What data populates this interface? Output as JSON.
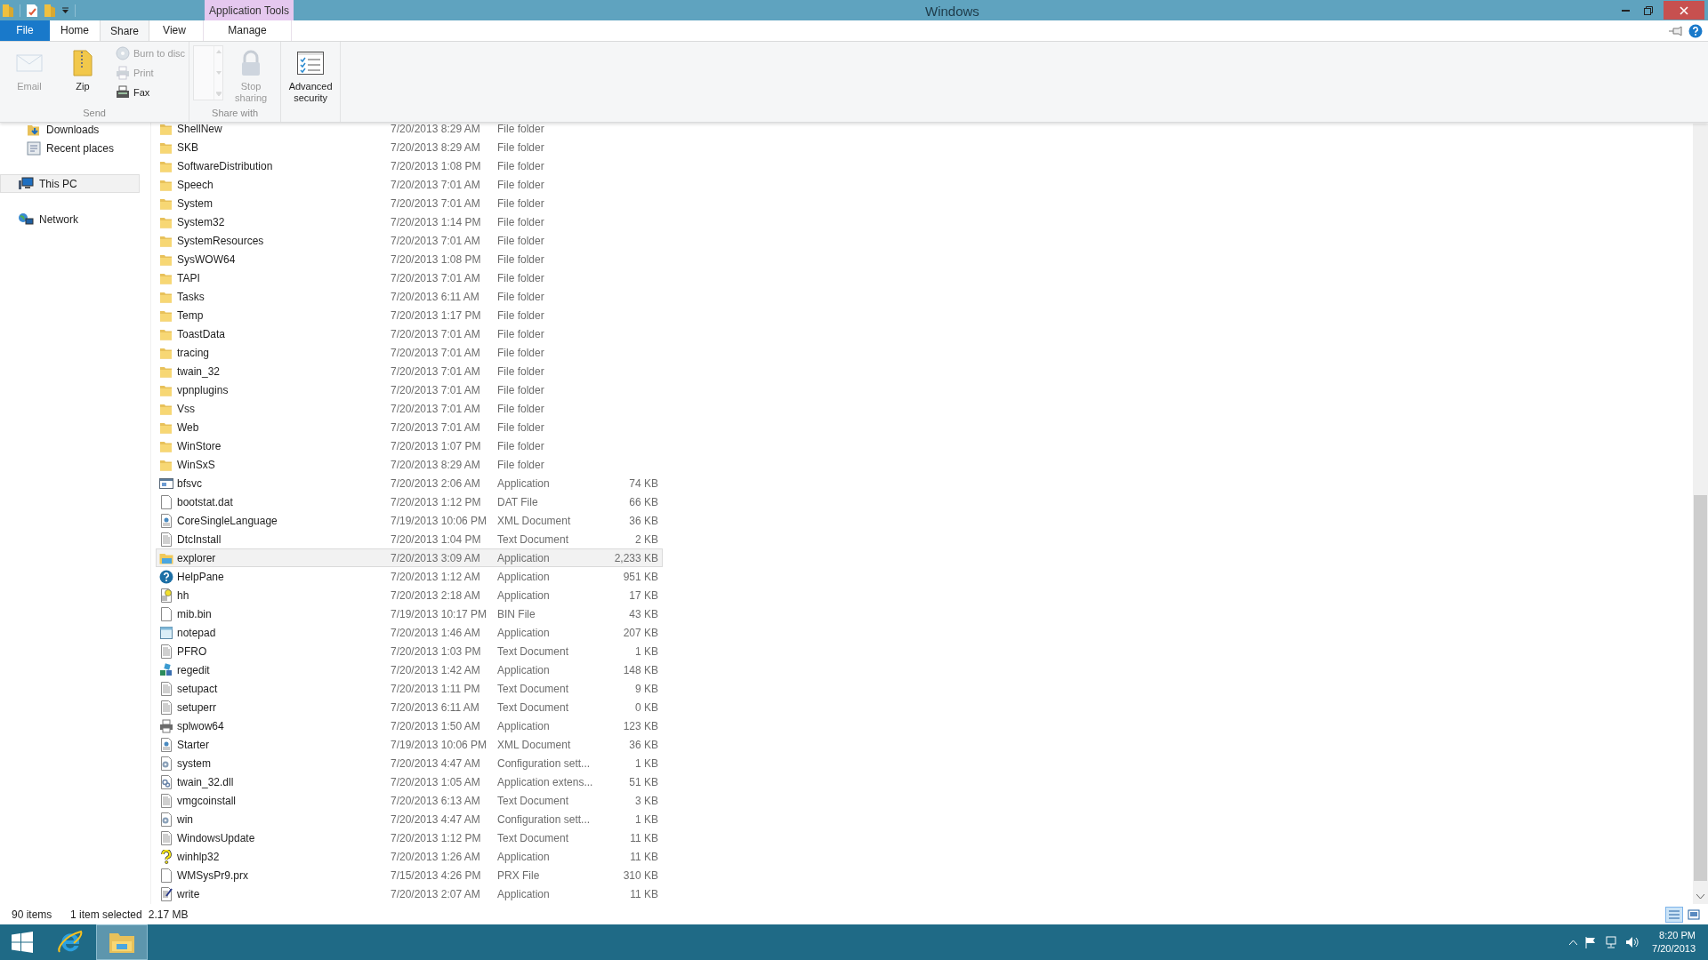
{
  "window": {
    "title": "Windows"
  },
  "contextual_tab": {
    "label": "Application Tools"
  },
  "tabs": [
    {
      "label": "File",
      "kind": "file",
      "selected": false
    },
    {
      "label": "Home",
      "kind": "tab",
      "selected": false
    },
    {
      "label": "Share",
      "kind": "tab",
      "selected": true
    },
    {
      "label": "View",
      "kind": "tab",
      "selected": false
    },
    {
      "label": "Manage",
      "kind": "contextual",
      "selected": false
    }
  ],
  "ribbon": {
    "groups": [
      {
        "label": "Send",
        "items": [
          {
            "label": "Email",
            "kind": "email",
            "disabled": true
          },
          {
            "label": "Zip",
            "kind": "zip",
            "disabled": false
          },
          {
            "label": "Burn to disc",
            "kind": "disc",
            "disabled": true
          },
          {
            "label": "Print",
            "kind": "print",
            "disabled": true
          },
          {
            "label": "Fax",
            "kind": "fax",
            "disabled": false
          }
        ]
      },
      {
        "label": "Share with",
        "items": [
          {
            "kind": "gallery",
            "disabled": true
          },
          {
            "label": "Stop sharing",
            "kind": "lock",
            "disabled": true
          }
        ]
      },
      {
        "items": [
          {
            "label": "Advanced security",
            "kind": "security",
            "disabled": false
          }
        ]
      }
    ]
  },
  "nav": {
    "items": [
      {
        "label": "Downloads",
        "kind": "downloads",
        "selected": false
      },
      {
        "label": "Recent places",
        "kind": "recent",
        "selected": false
      },
      {
        "label": "This PC",
        "kind": "pc",
        "selected": true
      },
      {
        "label": "Network",
        "kind": "network",
        "selected": false
      }
    ]
  },
  "files": [
    {
      "name": "ShellNew",
      "date": "7/20/2013 8:29 AM",
      "type": "File folder",
      "kind": "folder",
      "selected": false
    },
    {
      "name": "SKB",
      "date": "7/20/2013 8:29 AM",
      "type": "File folder",
      "kind": "folder",
      "selected": false
    },
    {
      "name": "SoftwareDistribution",
      "date": "7/20/2013 1:08 PM",
      "type": "File folder",
      "kind": "folder",
      "selected": false
    },
    {
      "name": "Speech",
      "date": "7/20/2013 7:01 AM",
      "type": "File folder",
      "kind": "folder",
      "selected": false
    },
    {
      "name": "System",
      "date": "7/20/2013 7:01 AM",
      "type": "File folder",
      "kind": "folder",
      "selected": false
    },
    {
      "name": "System32",
      "date": "7/20/2013 1:14 PM",
      "type": "File folder",
      "kind": "folder",
      "selected": false
    },
    {
      "name": "SystemResources",
      "date": "7/20/2013 7:01 AM",
      "type": "File folder",
      "kind": "folder",
      "selected": false
    },
    {
      "name": "SysWOW64",
      "date": "7/20/2013 1:08 PM",
      "type": "File folder",
      "kind": "folder",
      "selected": false
    },
    {
      "name": "TAPI",
      "date": "7/20/2013 7:01 AM",
      "type": "File folder",
      "kind": "folder",
      "selected": false
    },
    {
      "name": "Tasks",
      "date": "7/20/2013 6:11 AM",
      "type": "File folder",
      "kind": "folder",
      "selected": false
    },
    {
      "name": "Temp",
      "date": "7/20/2013 1:17 PM",
      "type": "File folder",
      "kind": "folder",
      "selected": false
    },
    {
      "name": "ToastData",
      "date": "7/20/2013 7:01 AM",
      "type": "File folder",
      "kind": "folder",
      "selected": false
    },
    {
      "name": "tracing",
      "date": "7/20/2013 7:01 AM",
      "type": "File folder",
      "kind": "folder",
      "selected": false
    },
    {
      "name": "twain_32",
      "date": "7/20/2013 7:01 AM",
      "type": "File folder",
      "kind": "folder",
      "selected": false
    },
    {
      "name": "vpnplugins",
      "date": "7/20/2013 7:01 AM",
      "type": "File folder",
      "kind": "folder",
      "selected": false
    },
    {
      "name": "Vss",
      "date": "7/20/2013 7:01 AM",
      "type": "File folder",
      "kind": "folder",
      "selected": false
    },
    {
      "name": "Web",
      "date": "7/20/2013 7:01 AM",
      "type": "File folder",
      "kind": "folder",
      "selected": false
    },
    {
      "name": "WinStore",
      "date": "7/20/2013 1:07 PM",
      "type": "File folder",
      "kind": "folder",
      "selected": false
    },
    {
      "name": "WinSxS",
      "date": "7/20/2013 8:29 AM",
      "type": "File folder",
      "kind": "folder",
      "selected": false
    },
    {
      "name": "bfsvc",
      "date": "7/20/2013 2:06 AM",
      "type": "Application",
      "size": "74 KB",
      "kind": "app",
      "selected": false
    },
    {
      "name": "bootstat.dat",
      "date": "7/20/2013 1:12 PM",
      "type": "DAT File",
      "size": "66 KB",
      "kind": "file",
      "selected": false
    },
    {
      "name": "CoreSingleLanguage",
      "date": "7/19/2013 10:06 PM",
      "type": "XML Document",
      "size": "36 KB",
      "kind": "xml",
      "selected": false
    },
    {
      "name": "DtcInstall",
      "date": "7/20/2013 1:04 PM",
      "type": "Text Document",
      "size": "2 KB",
      "kind": "text",
      "selected": false
    },
    {
      "name": "explorer",
      "date": "7/20/2013 3:09 AM",
      "type": "Application",
      "size": "2,233 KB",
      "kind": "explorer",
      "selected": true
    },
    {
      "name": "HelpPane",
      "date": "7/20/2013 1:12 AM",
      "type": "Application",
      "size": "951 KB",
      "kind": "help",
      "selected": false
    },
    {
      "name": "hh",
      "date": "7/20/2013 2:18 AM",
      "type": "Application",
      "size": "17 KB",
      "kind": "hh",
      "selected": false
    },
    {
      "name": "mib.bin",
      "date": "7/19/2013 10:17 PM",
      "type": "BIN File",
      "size": "43 KB",
      "kind": "file",
      "selected": false
    },
    {
      "name": "notepad",
      "date": "7/20/2013 1:46 AM",
      "type": "Application",
      "size": "207 KB",
      "kind": "notepad",
      "selected": false
    },
    {
      "name": "PFRO",
      "date": "7/20/2013 1:03 PM",
      "type": "Text Document",
      "size": "1 KB",
      "kind": "text",
      "selected": false
    },
    {
      "name": "regedit",
      "date": "7/20/2013 1:42 AM",
      "type": "Application",
      "size": "148 KB",
      "kind": "regedit",
      "selected": false
    },
    {
      "name": "setupact",
      "date": "7/20/2013 1:11 PM",
      "type": "Text Document",
      "size": "9 KB",
      "kind": "text",
      "selected": false
    },
    {
      "name": "setuperr",
      "date": "7/20/2013 6:11 AM",
      "type": "Text Document",
      "size": "0 KB",
      "kind": "text",
      "selected": false
    },
    {
      "name": "splwow64",
      "date": "7/20/2013 1:50 AM",
      "type": "Application",
      "size": "123 KB",
      "kind": "printer",
      "selected": false
    },
    {
      "name": "Starter",
      "date": "7/19/2013 10:06 PM",
      "type": "XML Document",
      "size": "36 KB",
      "kind": "xml",
      "selected": false
    },
    {
      "name": "system",
      "date": "7/20/2013 4:47 AM",
      "type": "Configuration sett...",
      "size": "1 KB",
      "kind": "config",
      "selected": false
    },
    {
      "name": "twain_32.dll",
      "date": "7/20/2013 1:05 AM",
      "type": "Application extens...",
      "size": "51 KB",
      "kind": "dll",
      "selected": false
    },
    {
      "name": "vmgcoinstall",
      "date": "7/20/2013 6:13 AM",
      "type": "Text Document",
      "size": "3 KB",
      "kind": "text",
      "selected": false
    },
    {
      "name": "win",
      "date": "7/20/2013 4:47 AM",
      "type": "Configuration sett...",
      "size": "1 KB",
      "kind": "config",
      "selected": false
    },
    {
      "name": "WindowsUpdate",
      "date": "7/20/2013 1:12 PM",
      "type": "Text Document",
      "size": "11 KB",
      "kind": "text",
      "selected": false
    },
    {
      "name": "winhlp32",
      "date": "7/20/2013 1:26 AM",
      "type": "Application",
      "size": "11 KB",
      "kind": "winhlp",
      "selected": false
    },
    {
      "name": "WMSysPr9.prx",
      "date": "7/15/2013 4:26 PM",
      "type": "PRX File",
      "size": "310 KB",
      "kind": "file",
      "selected": false
    },
    {
      "name": "write",
      "date": "7/20/2013 2:07 AM",
      "type": "Application",
      "size": "11 KB",
      "kind": "write",
      "selected": false
    }
  ],
  "status_bar": {
    "item_count": "90 items",
    "selection": "1 item selected",
    "selection_size": "2.17 MB"
  },
  "taskbar": {
    "apps": [
      {
        "kind": "ie",
        "selected": false
      },
      {
        "kind": "explorer",
        "selected": true
      }
    ],
    "clock": {
      "time": "8:20 PM",
      "date": "7/20/2013"
    }
  }
}
